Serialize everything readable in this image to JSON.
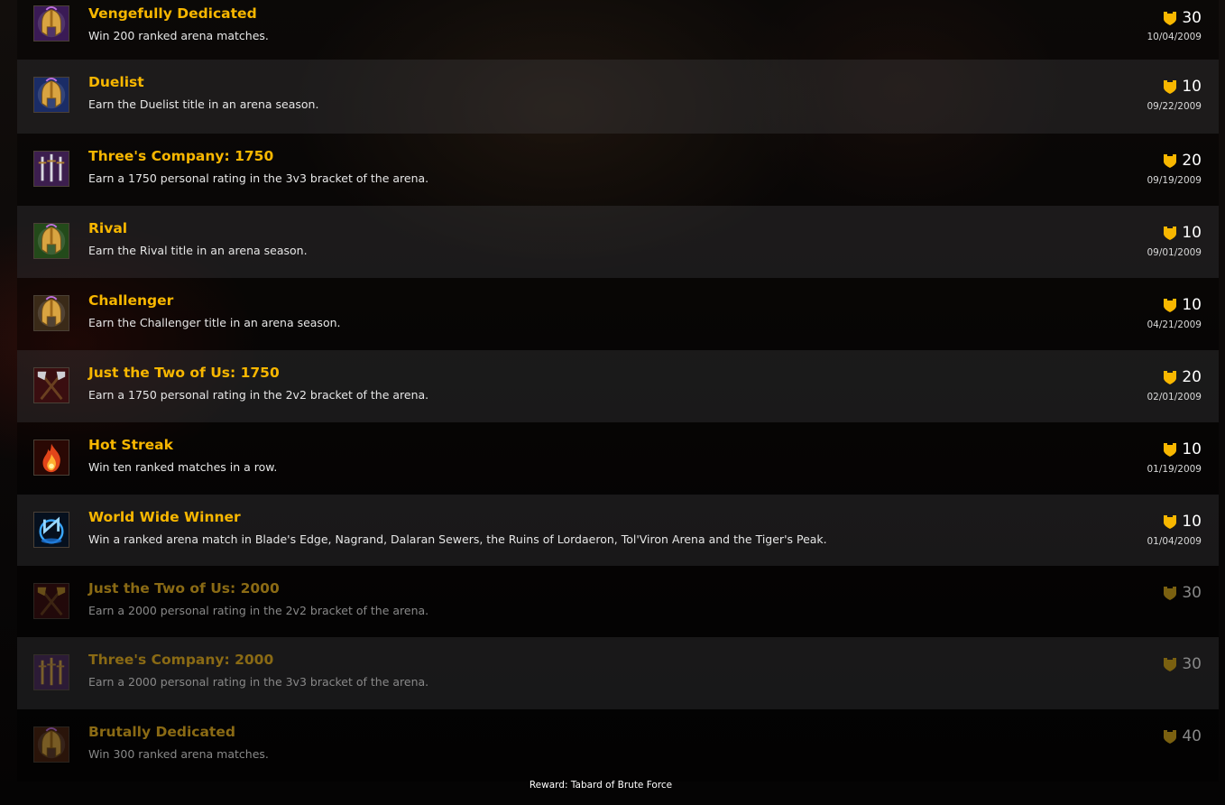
{
  "achievements": [
    {
      "title": "Vengefully Dedicated",
      "description": "Win 200 ranked arena matches.",
      "points": "30",
      "date": "10/04/2009",
      "icon": "gold-helm-purple-icon",
      "completed": true
    },
    {
      "title": "Duelist",
      "description": "Earn the Duelist title in an arena season.",
      "points": "10",
      "date": "09/22/2009",
      "icon": "gold-helm-blue-icon",
      "completed": true
    },
    {
      "title": "Three's Company: 1750",
      "description": "Earn a 1750 personal rating in the 3v3 bracket of the arena.",
      "points": "20",
      "date": "09/19/2009",
      "icon": "three-swords-icon",
      "completed": true
    },
    {
      "title": "Rival",
      "description": "Earn the Rival title in an arena season.",
      "points": "10",
      "date": "09/01/2009",
      "icon": "gold-helm-green-icon",
      "completed": true
    },
    {
      "title": "Challenger",
      "description": "Earn the Challenger title in an arena season.",
      "points": "10",
      "date": "04/21/2009",
      "icon": "gold-helm-plain-icon",
      "completed": true
    },
    {
      "title": "Just the Two of Us: 1750",
      "description": "Earn a 1750 personal rating in the 2v2 bracket of the arena.",
      "points": "20",
      "date": "02/01/2009",
      "icon": "crossed-axes-icon",
      "completed": true
    },
    {
      "title": "Hot Streak",
      "description": "Win ten ranked matches in a row.",
      "points": "10",
      "date": "01/19/2009",
      "icon": "fire-icon",
      "completed": true
    },
    {
      "title": "World Wide Winner",
      "description": "Win a ranked arena match in Blade's Edge, Nagrand, Dalaran Sewers, the Ruins of Lordaeron, Tol'Viron Arena and the Tiger's Peak.",
      "points": "10",
      "date": "01/04/2009",
      "icon": "arena-emblem-icon",
      "completed": true
    },
    {
      "title": "Just the Two of Us: 2000",
      "description": "Earn a 2000 personal rating in the 2v2 bracket of the arena.",
      "points": "30",
      "date": "",
      "icon": "crossed-axes-gold-icon",
      "completed": false
    },
    {
      "title": "Three's Company: 2000",
      "description": "Earn a 2000 personal rating in the 3v3 bracket of the arena.",
      "points": "30",
      "date": "",
      "icon": "three-swords-gold-icon",
      "completed": false
    },
    {
      "title": "Brutally Dedicated",
      "description": "Win 300 ranked arena matches.",
      "points": "40",
      "date": "",
      "icon": "gold-helm-orange-icon",
      "completed": false
    }
  ],
  "reward": "Reward: Tabard of Brute Force",
  "colors": {
    "title_completed": "#f8b700",
    "title_locked": "#8a6a14",
    "shield_completed": "#f8b700",
    "shield_locked": "#7a6010"
  }
}
